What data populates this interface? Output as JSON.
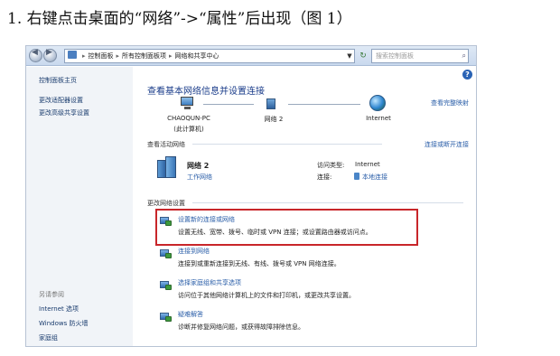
{
  "caption": "1. 右键点击桌面的“网络”->“属性”后出现（图 1）",
  "address_bar": {
    "crumbs": [
      "控制面板",
      "所有控制面板项",
      "网络和共享中心"
    ],
    "search_placeholder": "搜索控制面板"
  },
  "sidebar": {
    "top_items": [
      "控制面板主页",
      "更改适配器设置",
      "更改高级共享设置"
    ],
    "see_also_header": "另请参阅",
    "see_also_items": [
      "Internet 选项",
      "Windows 防火墙",
      "家庭组"
    ]
  },
  "main": {
    "title": "查看基本网络信息并设置连接",
    "full_map_link": "查看完整映射",
    "map_nodes": [
      {
        "label": "CHAOQUN-PC",
        "sublabel": "(此计算机)"
      },
      {
        "label": "网络  2",
        "sublabel": ""
      },
      {
        "label": "Internet",
        "sublabel": ""
      }
    ],
    "active_networks_label": "查看活动网络",
    "connect_disconnect_link": "连接或断开连接",
    "network": {
      "name": "网络  2",
      "type_link": "工作网络",
      "access_type_label": "访问类型:",
      "access_type_value": "Internet",
      "connections_label": "连接:",
      "connections_value": "本地连接"
    },
    "change_settings_label": "更改网络设置",
    "tasks": [
      {
        "link": "设置新的连接或网络",
        "desc": "设置无线、宽带、拨号、临时或 VPN 连接；或设置路由器或访问点。"
      },
      {
        "link": "连接到网络",
        "desc": "连接到或重新连接到无线、有线、拨号或 VPN 网络连接。"
      },
      {
        "link": "选择家庭组和共享选项",
        "desc": "访问位于其他网络计算机上的文件和打印机，或更改共享设置。"
      },
      {
        "link": "疑难解答",
        "desc": "诊断并修复网络问题，或获得故障排除信息。"
      }
    ]
  },
  "colors": {
    "link": "#2a5ea8",
    "highlight_box": "#c8262a",
    "sidebar_bg": "#f1f4f8"
  }
}
